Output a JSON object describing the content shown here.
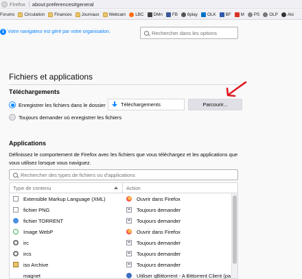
{
  "browser": {
    "brand": "Firefox",
    "url": "about:preferences#general"
  },
  "bookmarks": [
    {
      "label": "Forums",
      "icon": "none"
    },
    {
      "label": "Circulation",
      "icon": "folder-icon"
    },
    {
      "label": "Finances",
      "icon": "folder-icon"
    },
    {
      "label": "Journaux",
      "icon": "folder-icon"
    },
    {
      "label": "Webcam",
      "icon": "folder-icon"
    },
    {
      "label": "LBC",
      "icon": "lbc-icon"
    },
    {
      "label": "DMn",
      "icon": "dmn-icon"
    },
    {
      "label": "FB",
      "icon": "facebook-icon"
    },
    {
      "label": "6play",
      "icon": "6play-icon"
    },
    {
      "label": "OLK",
      "icon": "outlook-icon"
    },
    {
      "label": "BF",
      "icon": "bf-icon"
    },
    {
      "label": "M",
      "icon": "gmail-icon"
    },
    {
      "label": "PS",
      "icon": "ps-icon"
    },
    {
      "label": "OLP",
      "icon": "olp-icon"
    },
    {
      "label": "Alo",
      "icon": "alo-icon"
    }
  ],
  "notice": "Votre navigateur est géré par votre organisation.",
  "options_search": {
    "placeholder": "Rechercher dans les options"
  },
  "section": {
    "title": "Fichiers et applications",
    "downloads": {
      "title": "Téléchargements",
      "save_option": "Enregistrer les fichiers dans le dossier",
      "folder": "Téléchargements",
      "browse_button": "Parcourir...",
      "ask_option": "Toujours demander où enregistrer les fichiers"
    },
    "applications": {
      "title": "Applications",
      "description": "Définissez le comportement de Firefox avec les fichiers que vous téléchargez et les applications que vous utilisez lorsque vous naviguez.",
      "search_placeholder": "Rechercher des types de fichiers ou d'applications",
      "columns": {
        "type": "Type de contenu",
        "action": "Action"
      },
      "rows": [
        {
          "type": "Extensible Markup Language (XML)",
          "type_icon": "doc-icon",
          "action": "Ouvrir dans Firefox",
          "action_icon": "firefox-icon"
        },
        {
          "type": "fichier PNG",
          "type_icon": "doc-icon",
          "action": "Toujours demander",
          "action_icon": "app-icon"
        },
        {
          "type": "fichier TORRENT",
          "type_icon": "torrent-icon",
          "action": "Toujours demander",
          "action_icon": "app-icon"
        },
        {
          "type": "Image WebP",
          "type_icon": "webp-icon",
          "action": "Ouvrir dans Firefox",
          "action_icon": "firefox-icon"
        },
        {
          "type": "irc",
          "type_icon": "gear-icon",
          "action": "Toujours demander",
          "action_icon": "app-icon"
        },
        {
          "type": "ircs",
          "type_icon": "gear-icon",
          "action": "Toujours demander",
          "action_icon": "app-icon"
        },
        {
          "type": "iso Archive",
          "type_icon": "archive-icon",
          "action": "Toujours demander",
          "action_icon": "app-icon"
        },
        {
          "type": "magnet",
          "type_icon": "none",
          "action": "Utiliser qBittorrent - A Bittorrent Client (pa",
          "action_icon": "qbittorrent-icon"
        }
      ]
    }
  },
  "colors": {
    "accent": "#0a84ff",
    "annotation_arrow": "#e0191f"
  }
}
